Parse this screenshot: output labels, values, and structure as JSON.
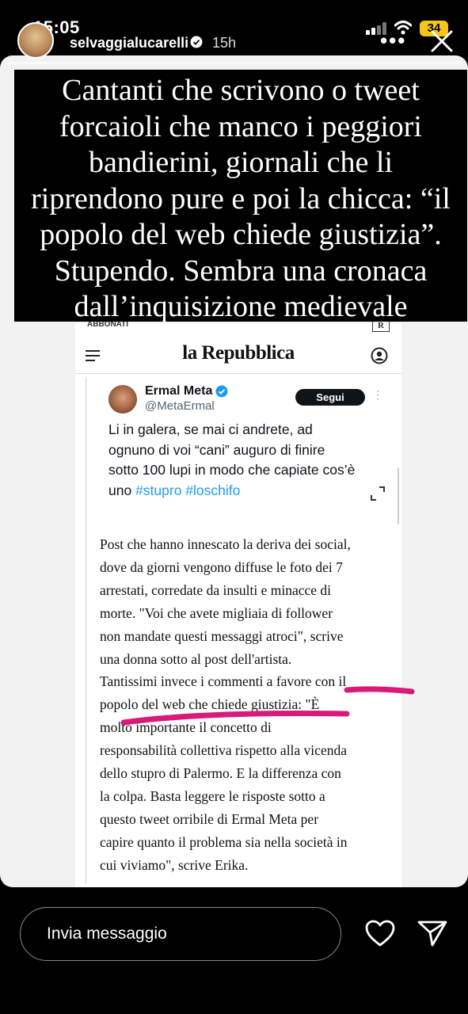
{
  "status_bar": {
    "time": "15:05",
    "battery": "34"
  },
  "story": {
    "username": "selvaggialucarelli",
    "time_ago": "15h",
    "caption_lines": [
      "Cantanti che scrivono o tweet",
      "forcaioli che manco i peggiori",
      "bandierini, giornali che li",
      "riprendono pure e poi la chicca: “il",
      "popolo del web chiede giustizia”.",
      "Stupendo. Sembra una cronaca",
      "dall’inquisizione medievale"
    ]
  },
  "article": {
    "header_top": "ABBONATI",
    "logo": "la Repubblica",
    "small_logo": "R",
    "tweet": {
      "name": "Ermal Meta",
      "handle": "@MetaErmal",
      "follow_label": "Segui",
      "more": "⋮",
      "text_lines": [
        "Li in galera, se mai ci andrete, ad",
        "ognuno di voi “cani” auguro di finire",
        "sotto 100 lupi in modo che capiate cos’è"
      ],
      "last_line_prefix": "uno ",
      "hashtags": "#stupro #loschifo"
    },
    "body_lines": [
      "Post che hanno innescato la deriva dei social,",
      "dove da giorni vengono diffuse le foto dei 7",
      "arrestati, corredate da insulti e minacce di",
      "morte. \"Voi che avete migliaia di follower",
      "non mandate questi messaggi atroci\", scrive",
      "una donna sotto al post dell'artista.",
      "Tantissimi invece i commenti a favore con il",
      "popolo del web che chiede giustizia: \"È",
      "molto importante il concetto di",
      "responsabilità collettiva rispetto alla vicenda",
      "dello stupro di Palermo. E la  differenza con",
      "la colpa. Basta leggere le risposte sotto a",
      "questo tweet orribile di Ermal Meta per",
      "capire quanto il problema sia nella società in",
      "cui viviamo\", scrive Erika."
    ],
    "highlight_color": "#d81b7a"
  },
  "bottom_bar": {
    "placeholder": "Invia messaggio"
  }
}
